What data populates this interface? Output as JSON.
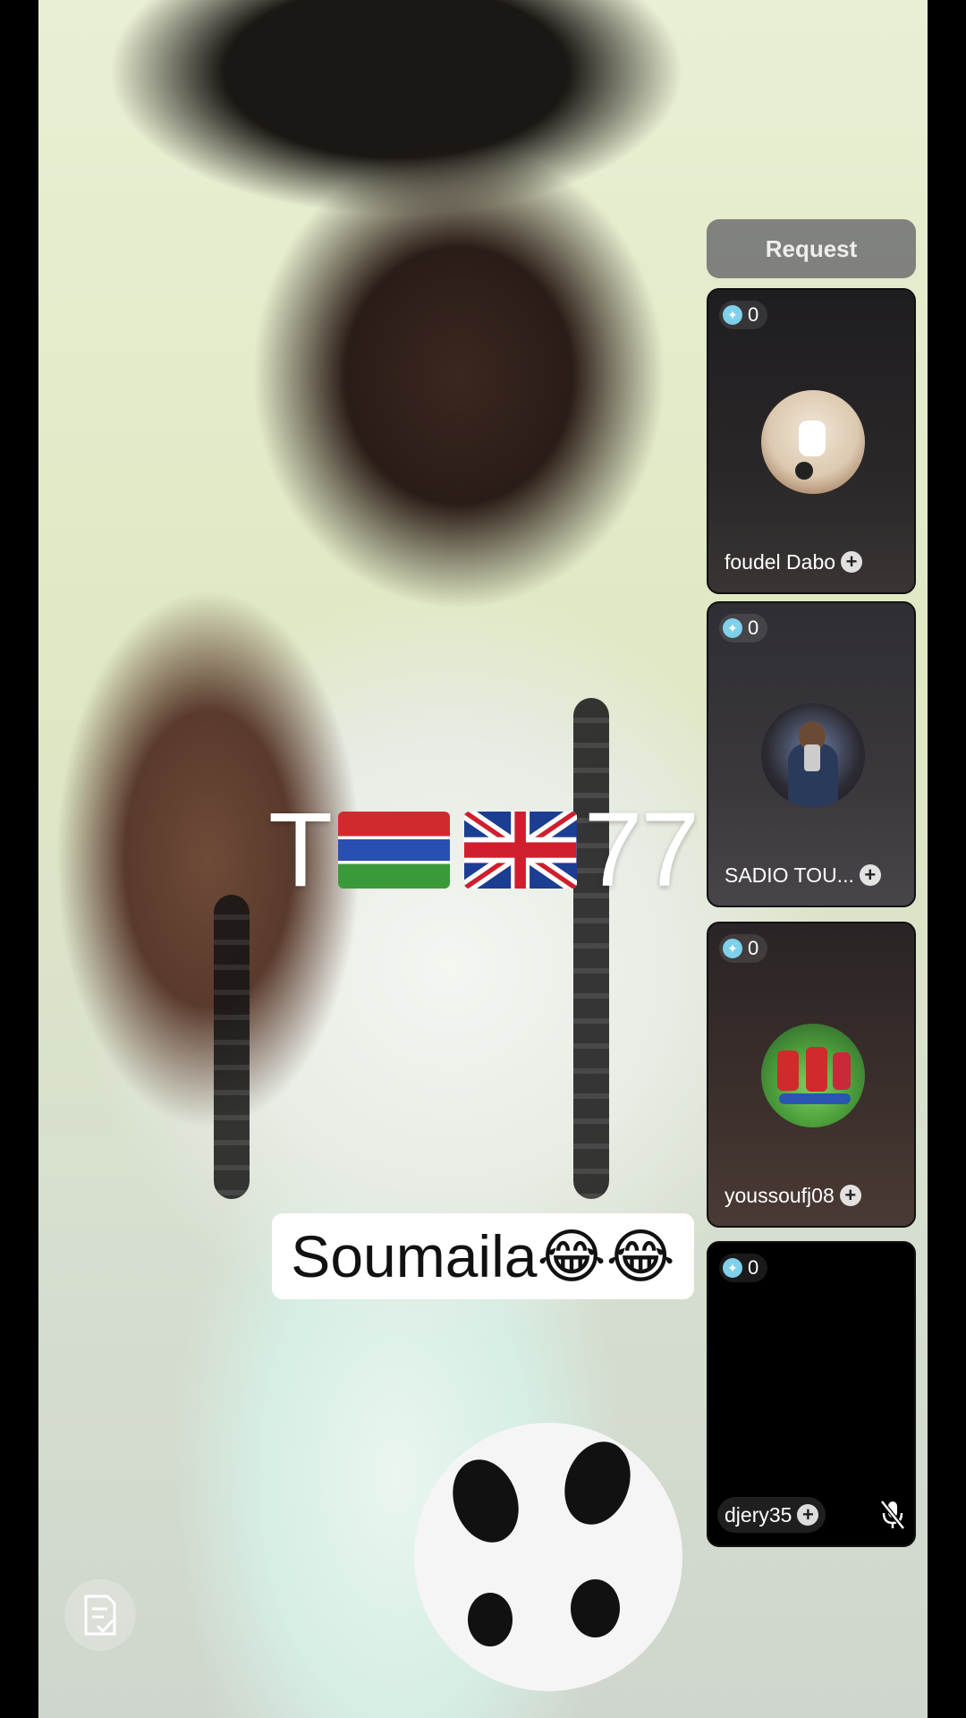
{
  "stream": {
    "title_prefix": "T",
    "title_suffix": "77",
    "caption": "Soumaila😂😂"
  },
  "request_button": {
    "label": "Request"
  },
  "guests": [
    {
      "score": "0",
      "name": "foudel Dabo"
    },
    {
      "score": "0",
      "name": "SADIO TOU..."
    },
    {
      "score": "0",
      "name": "youssoufj08"
    },
    {
      "score": "0",
      "name": "djery35",
      "muted": true
    }
  ],
  "icons": {
    "follow": "+",
    "gem": "gem-icon",
    "mute": "mic-off-icon",
    "report": "document-check-icon"
  },
  "colors": {
    "gem": "#7fd0ea",
    "request_bg": "#6e6e6e",
    "caption_bg": "#ffffff"
  }
}
